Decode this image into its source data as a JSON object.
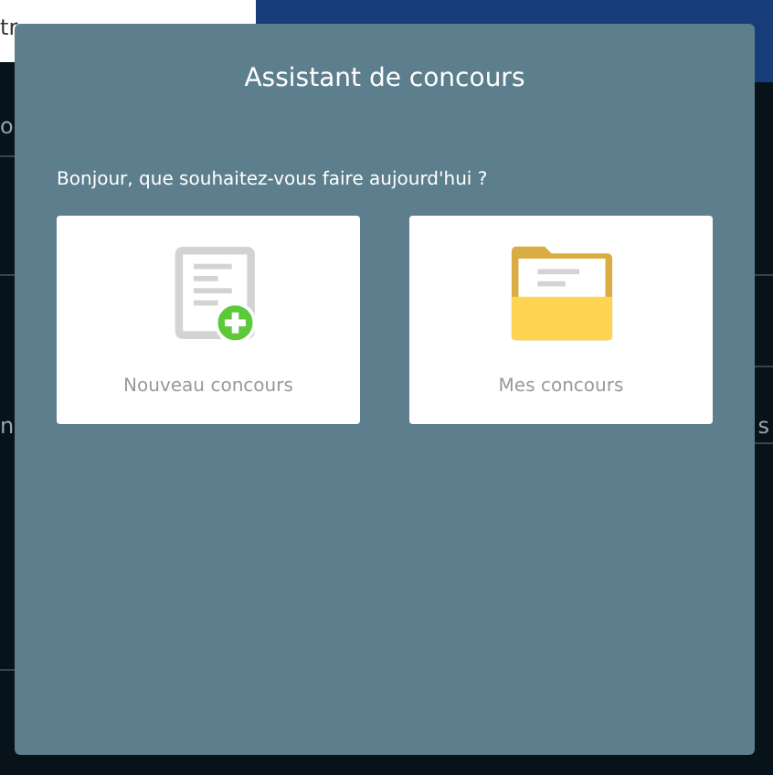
{
  "background": {
    "left_fragments": [
      "tr",
      "o",
      "n"
    ],
    "right_fragments": [
      "s"
    ]
  },
  "dialog": {
    "title": "Assistant de concours",
    "prompt": "Bonjour, que souhaitez-vous faire aujourd'hui ?",
    "options": [
      {
        "kind": "new",
        "label": "Nouveau concours"
      },
      {
        "kind": "folder",
        "label": "Mes concours"
      }
    ]
  }
}
